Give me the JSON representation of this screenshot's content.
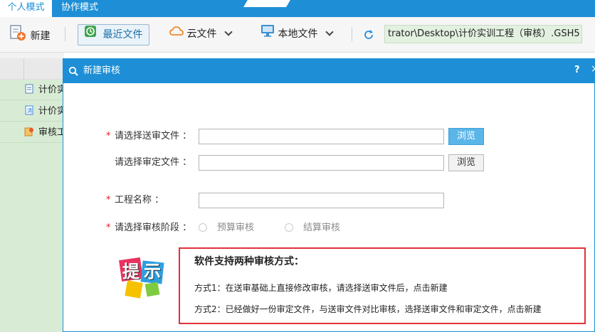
{
  "tabs": [
    {
      "label": "个人模式"
    },
    {
      "label": "协作模式"
    }
  ],
  "toolbar": {
    "new_label": "新建",
    "recent_label": "最近文件",
    "cloud_label": "云文件",
    "local_label": "本地文件",
    "path": "trator\\Desktop\\计价实训工程（审核）.GSH5"
  },
  "sidebar": {
    "items": [
      {
        "label": "计价实"
      },
      {
        "label": "计价实"
      },
      {
        "label": "审核工"
      }
    ]
  },
  "dialog": {
    "title": "新建审核",
    "help": "?",
    "close": "×",
    "required_mark": "*",
    "send_file_label": "请选择送审文件 ：",
    "send_file_value": "",
    "approved_file_label": "请选择审定文件 ：",
    "approved_file_value": "",
    "browse_label": "浏览",
    "project_name_label": "工程名称 ：",
    "project_name_value": "",
    "stage_label": "请选择审核阶段 ：",
    "stage_options": [
      "预算审核",
      "结算审核"
    ],
    "tip_logo_text": "提示",
    "tip_title": "软件支持两种审核方式：",
    "tip_line1": "方式1：在送审基础上直接修改审核，请选择送审文件后，点击新建",
    "tip_line2": "方式2：已经做好一份审定文件，与送审文件对比审核，选择送审文件和审定文件，点击新建"
  },
  "colors": {
    "accent": "#1e8fd6",
    "required": "#d92020",
    "tip_border": "#e0313a",
    "tree_bg": "#d8ecd5"
  }
}
